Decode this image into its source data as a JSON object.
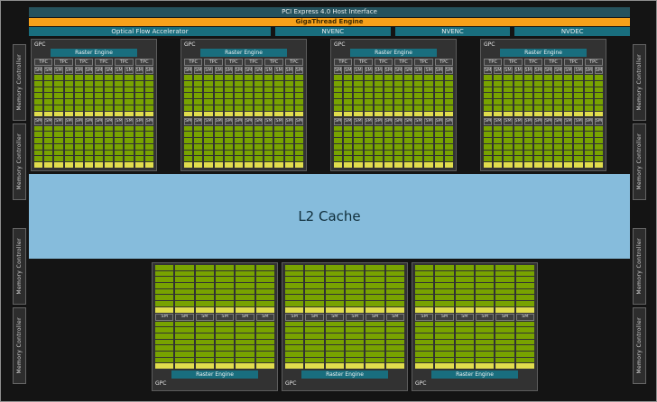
{
  "header": {
    "pci_host_interface": "PCI Express 4.0 Host Interface",
    "gigathread_engine": "GigaThread Engine",
    "optical_flow_accelerator": "Optical Flow Accelerator",
    "media_engines": [
      "NVENC",
      "NVENC",
      "NVDEC"
    ]
  },
  "labels": {
    "gpc": "GPC",
    "raster_engine": "Raster Engine",
    "tpc": "TPC",
    "sm": "SM",
    "memory_controller": "Memory Controller",
    "l2_cache": "L2 Cache"
  },
  "structure": {
    "top_gpc_count": 4,
    "tpcs_per_gpc": 6,
    "sm_columns_per_tpc": 2,
    "sm_segments_per_column": 2,
    "core_rows_per_sm": 7,
    "bottom_gpc_count": 3,
    "sm_columns_per_bottom_gpc": 6,
    "bottom_core_rows_per_half": 8,
    "memory_controllers_per_side": 4
  },
  "colors": {
    "green": "#78a300",
    "yellow": "#e0dd4d",
    "teal": "#196e7e",
    "teal-dark": "#26525d",
    "orange": "#f7a11a",
    "l2-blue": "#86bcdc",
    "gpc-bg": "#323232",
    "canvas-bg": "#141414"
  }
}
